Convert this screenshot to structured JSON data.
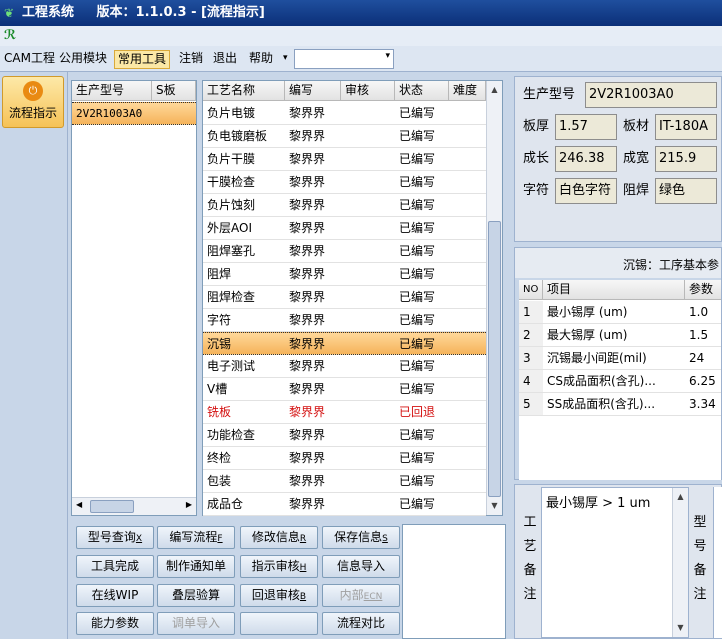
{
  "title_bar": {
    "app": "工程系统",
    "version_text": "版本：1.1.0.3 - [流程指示]"
  },
  "menu": {
    "items": [
      "CAM工程",
      "公用模块",
      "常用工具",
      "注销",
      "退出",
      "帮助"
    ],
    "active_item": "常用工具",
    "dropdown_arrow": "▾",
    "combo_value": ""
  },
  "left_nav": {
    "flow_button_label": "流程指示",
    "flow_button_icon": "power-icon"
  },
  "model_list": {
    "columns": [
      "生产型号",
      "S板"
    ],
    "rows": [
      {
        "model": "2V2R1003A0",
        "s": ""
      }
    ]
  },
  "process_table": {
    "columns": [
      "工艺名称",
      "编写",
      "审核",
      "状态",
      "难度"
    ],
    "rows": [
      {
        "name": "负片电镀",
        "writer": "黎界界",
        "reviewer": "",
        "status": "已编写",
        "difficulty": ""
      },
      {
        "name": "负电镀磨板",
        "writer": "黎界界",
        "reviewer": "",
        "status": "已编写",
        "difficulty": ""
      },
      {
        "name": "负片干膜",
        "writer": "黎界界",
        "reviewer": "",
        "status": "已编写",
        "difficulty": ""
      },
      {
        "name": "干膜检查",
        "writer": "黎界界",
        "reviewer": "",
        "status": "已编写",
        "difficulty": ""
      },
      {
        "name": "负片蚀刻",
        "writer": "黎界界",
        "reviewer": "",
        "status": "已编写",
        "difficulty": ""
      },
      {
        "name": "外层AOI",
        "writer": "黎界界",
        "reviewer": "",
        "status": "已编写",
        "difficulty": ""
      },
      {
        "name": "阻焊塞孔",
        "writer": "黎界界",
        "reviewer": "",
        "status": "已编写",
        "difficulty": ""
      },
      {
        "name": "阻焊",
        "writer": "黎界界",
        "reviewer": "",
        "status": "已编写",
        "difficulty": ""
      },
      {
        "name": "阻焊检查",
        "writer": "黎界界",
        "reviewer": "",
        "status": "已编写",
        "difficulty": ""
      },
      {
        "name": "字符",
        "writer": "黎界界",
        "reviewer": "",
        "status": "已编写",
        "difficulty": ""
      },
      {
        "name": "沉锡",
        "writer": "黎界界",
        "reviewer": "",
        "status": "已编写",
        "difficulty": ""
      },
      {
        "name": "电子测试",
        "writer": "黎界界",
        "reviewer": "",
        "status": "已编写",
        "difficulty": ""
      },
      {
        "name": "V槽",
        "writer": "黎界界",
        "reviewer": "",
        "status": "已编写",
        "difficulty": ""
      },
      {
        "name": "铣板",
        "writer": "黎界界",
        "reviewer": "",
        "status": "已回退",
        "difficulty": ""
      },
      {
        "name": "功能检查",
        "writer": "黎界界",
        "reviewer": "",
        "status": "已编写",
        "difficulty": ""
      },
      {
        "name": "终检",
        "writer": "黎界界",
        "reviewer": "",
        "status": "已编写",
        "difficulty": ""
      },
      {
        "name": "包装",
        "writer": "黎界界",
        "reviewer": "",
        "status": "已编写",
        "difficulty": ""
      },
      {
        "name": "成品仓",
        "writer": "黎界界",
        "reviewer": "",
        "status": "已编写",
        "difficulty": ""
      }
    ],
    "selected_row_index": 10,
    "rejected_row_index": 13,
    "rejected_color": "#d41010",
    "selection_color": "#f5b35a"
  },
  "buttons": {
    "model_query": {
      "label": "型号查询",
      "key": "X"
    },
    "edit_flow": {
      "label": "编写流程",
      "key": "F"
    },
    "modify_info": {
      "label": "修改信息",
      "key": "R"
    },
    "save_info": {
      "label": "保存信息",
      "key": "S"
    },
    "tool_done": "工具完成",
    "make_notice": "制作通知单",
    "instr_review": {
      "label": "指示审核",
      "key": "H"
    },
    "info_import": "信息导入",
    "online_wip": "在线WIP",
    "stack_check": "叠层验算",
    "rollback_review": {
      "label": "回退审核",
      "key": "B"
    },
    "internal_ecn": {
      "label": "内部",
      "key": "ECN"
    },
    "capability": "能力参数",
    "order_import": "调单导入",
    "blank": "",
    "flow_compare": "流程对比"
  },
  "info": {
    "model_label": "生产型号",
    "model_value": "2V2R1003A0",
    "thickness_label": "板厚",
    "thickness_value": "1.57",
    "material_label": "板材",
    "material_value": "IT-180A",
    "length_label": "成长",
    "length_value": "246.38",
    "width_label": "成宽",
    "width_value": "215.9",
    "char_label": "字符",
    "char_value": "白色字符",
    "mask_label": "阻焊",
    "mask_value": "绿色"
  },
  "params": {
    "title": "沉锡：工序基本参",
    "columns": [
      "NO",
      "项目",
      "参数"
    ],
    "rows": [
      {
        "no": "1",
        "item": "最小锡厚 (um)",
        "value": "1.0"
      },
      {
        "no": "2",
        "item": "最大锡厚 (um)",
        "value": "1.5"
      },
      {
        "no": "3",
        "item": "沉锡最小间距(mil)",
        "value": "24"
      },
      {
        "no": "4",
        "item": "CS成品面积(含孔)...",
        "value": "6.25"
      },
      {
        "no": "5",
        "item": "SS成品面积(含孔)...",
        "value": "3.34"
      }
    ]
  },
  "notes": {
    "process_label": "工艺备注",
    "process_text": "最小锡厚 > 1 um",
    "model_label": "型号备注"
  }
}
